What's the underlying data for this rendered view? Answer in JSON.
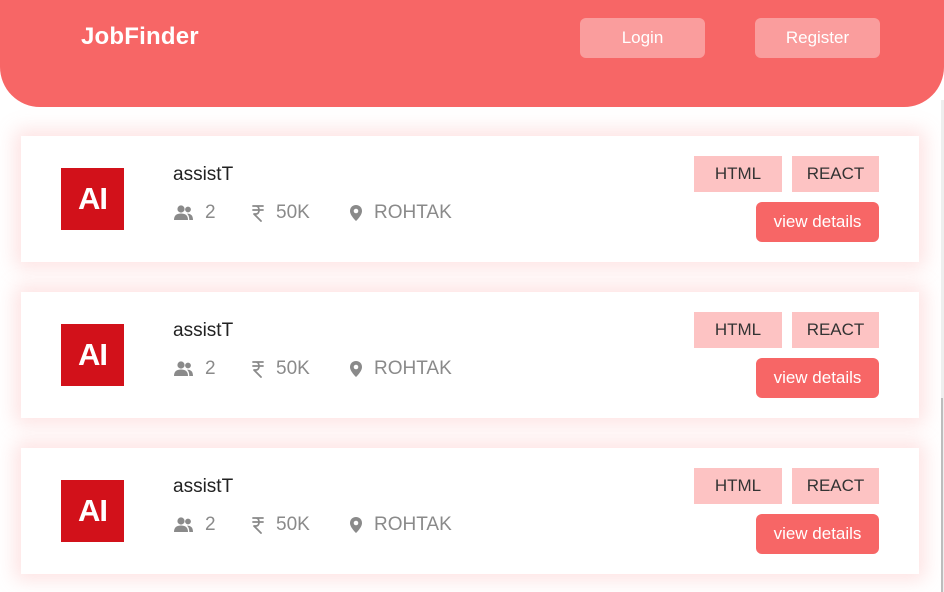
{
  "header": {
    "brand": "JobFinder",
    "login_label": "Login",
    "register_label": "Register"
  },
  "colors": {
    "accent": "#f76666",
    "button_light": "#fa9d9d",
    "tag_bg": "#fdc3c3",
    "logo_bg": "#d2111a"
  },
  "jobs": [
    {
      "logo_text": "AI",
      "title": "assistT",
      "openings": "2",
      "salary": "50K",
      "location": "ROHTAK",
      "tags": [
        "HTML",
        "REACT"
      ],
      "details_label": "view details"
    },
    {
      "logo_text": "AI",
      "title": "assistT",
      "openings": "2",
      "salary": "50K",
      "location": "ROHTAK",
      "tags": [
        "HTML",
        "REACT"
      ],
      "details_label": "view details"
    },
    {
      "logo_text": "AI",
      "title": "assistT",
      "openings": "2",
      "salary": "50K",
      "location": "ROHTAK",
      "tags": [
        "HTML",
        "REACT"
      ],
      "details_label": "view details"
    }
  ],
  "icons": {
    "openings": "people-icon",
    "salary": "rupee-icon",
    "location": "location-pin-icon"
  }
}
